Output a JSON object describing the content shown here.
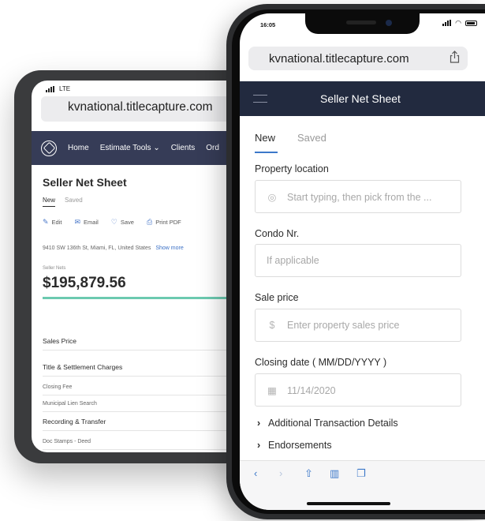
{
  "back_phone": {
    "status": {
      "network": "LTE"
    },
    "url": "kvnational.titlecapture.com",
    "nav": {
      "home": "Home",
      "estimate_tools": "Estimate Tools",
      "clients": "Clients",
      "orders": "Ord"
    },
    "page_title": "Seller Net Sheet",
    "tabs": {
      "new": "New",
      "saved": "Saved"
    },
    "actions": {
      "edit": "Edit",
      "email": "Email",
      "save": "Save",
      "print": "Print PDF"
    },
    "address": "9410 SW 136th St, Miami, FL, United States",
    "show_more": "Show more",
    "seller_nets_label": "Seller Nets",
    "seller_nets_amount": "$195,879.56",
    "rows": {
      "sales_price": "Sales Price",
      "title_settlement": "Title & Settlement Charges",
      "closing_fee": "Closing Fee",
      "municipal_lien": "Municipal Lien Search",
      "recording_transfer": "Recording & Transfer",
      "doc_stamps": "Doc Stamps - Deed"
    }
  },
  "front_phone": {
    "status": {
      "time": "16:05"
    },
    "url": "kvnational.titlecapture.com",
    "header_title": "Seller Net Sheet",
    "tabs": {
      "new": "New",
      "saved": "Saved"
    },
    "fields": {
      "property_location": {
        "label": "Property location",
        "placeholder": "Start typing, then pick from the ..."
      },
      "condo": {
        "label": "Condo Nr.",
        "placeholder": "If applicable"
      },
      "sale_price": {
        "label": "Sale price",
        "placeholder": "Enter property sales price"
      },
      "closing_date": {
        "label": "Closing date ( MM/DD/YYYY )",
        "value": "11/14/2020"
      }
    },
    "sections": {
      "additional": "Additional Transaction Details",
      "endorsements": "Endorsements"
    },
    "colors": {
      "header_bg": "#222a3f",
      "accent": "#3c78c9",
      "progress": "#6ccab0"
    }
  }
}
